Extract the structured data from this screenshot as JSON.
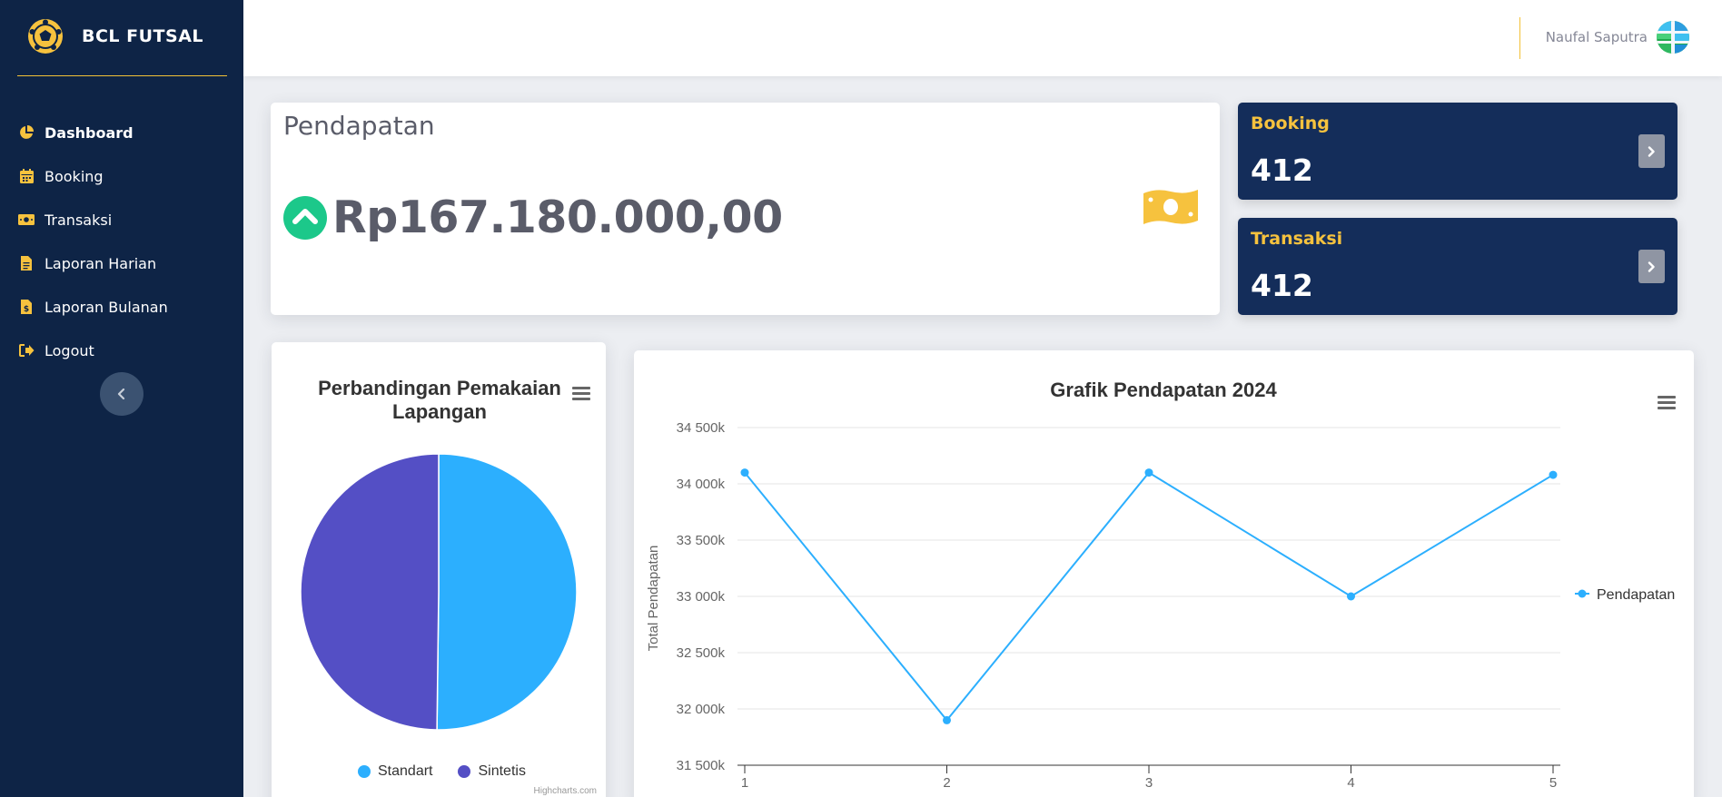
{
  "brand": {
    "name": "BCL FUTSAL"
  },
  "sidebar": {
    "items": [
      {
        "label": "Dashboard",
        "icon": "chart-pie-icon",
        "active": true
      },
      {
        "label": "Booking",
        "icon": "calendar-icon",
        "active": false
      },
      {
        "label": "Transaksi",
        "icon": "money-bill-icon",
        "active": false
      },
      {
        "label": "Laporan Harian",
        "icon": "file-icon",
        "active": false
      },
      {
        "label": "Laporan Bulanan",
        "icon": "file-invoice-icon",
        "active": false
      },
      {
        "label": "Logout",
        "icon": "sign-out-icon",
        "active": false
      }
    ],
    "collapse_icon": "chevron-left-icon"
  },
  "topbar": {
    "user_name": "Naufal Saputra"
  },
  "revenue": {
    "title": "Pendapatan",
    "value": "Rp167.180.000,00"
  },
  "stats": [
    {
      "label": "Booking",
      "value": "412"
    },
    {
      "label": "Transaksi",
      "value": "412"
    }
  ],
  "colors": {
    "sidebar": "#0e2446",
    "accent": "#f6c23e",
    "stat_card": "#142d5a",
    "series_blue": "#2caffe",
    "series_purple": "#544fc5",
    "up_green": "#1cc88a"
  },
  "chart_data": [
    {
      "type": "pie",
      "title": "Perbandingan Pemakaian Lapangan",
      "categories": [
        "Standart",
        "Sintetis"
      ],
      "values": [
        50.2,
        49.8
      ],
      "colors": [
        "#2caffe",
        "#544fc5"
      ],
      "legend": "bottom",
      "credits": "Highcharts.com"
    },
    {
      "type": "line",
      "title": "Grafik Pendapatan 2024",
      "ylabel": "Total Pendapatan",
      "xlabel": "",
      "x": [
        1,
        2,
        3,
        4,
        5
      ],
      "series": [
        {
          "name": "Pendapatan",
          "values": [
            34100000,
            31900000,
            34100000,
            33000000,
            34080000
          ]
        }
      ],
      "ylim": [
        31500000,
        34500000
      ],
      "yticks": [
        "31 500k",
        "32 000k",
        "32 500k",
        "33 000k",
        "33 500k",
        "34 000k",
        "34 500k"
      ],
      "grid": true,
      "legend": "right"
    }
  ]
}
